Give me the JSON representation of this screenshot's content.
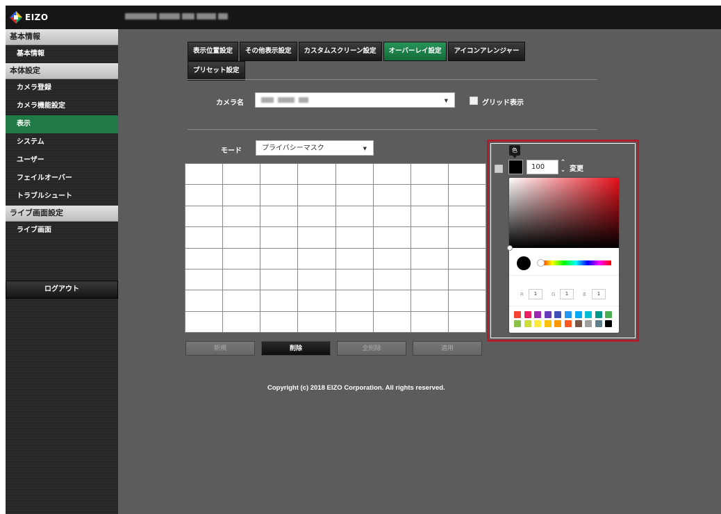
{
  "header": {
    "brand": "EIZO",
    "device_name_blurred_chunks": [
      46,
      30,
      18,
      28,
      14
    ]
  },
  "sidebar": {
    "sections": [
      {
        "title": "基本情報",
        "items": [
          {
            "label": "基本情報",
            "active": false
          }
        ]
      },
      {
        "title": "本体設定",
        "items": [
          {
            "label": "カメラ登録",
            "active": false
          },
          {
            "label": "カメラ機能設定",
            "active": false
          },
          {
            "label": "表示",
            "active": true
          },
          {
            "label": "システム",
            "active": false
          },
          {
            "label": "ユーザー",
            "active": false
          },
          {
            "label": "フェイルオーバー",
            "active": false
          },
          {
            "label": "トラブルシュート",
            "active": false
          }
        ]
      },
      {
        "title": "ライブ画面設定",
        "items": [
          {
            "label": "ライブ画面",
            "active": false
          }
        ]
      }
    ],
    "logout": "ログアウト"
  },
  "tabs": {
    "row1": [
      "表示位置設定",
      "その他表示設定",
      "カスタムスクリーン設定",
      "オーバーレイ設定",
      "アイコンアレンジャー"
    ],
    "row2": [
      "プリセット設定"
    ],
    "active": "オーバーレイ設定"
  },
  "camera": {
    "label": "カメラ名",
    "value_blurred": true,
    "grid_checkbox_label": "グリッド表示",
    "grid_checked": false
  },
  "mode": {
    "label": "モード",
    "value": "プライバシーマスク"
  },
  "grid": {
    "rows": 8,
    "cols": 8
  },
  "buttons": [
    {
      "label": "新規",
      "enabled": false
    },
    {
      "label": "削除",
      "enabled": true
    },
    {
      "label": "全削除",
      "enabled": false
    },
    {
      "label": "適用",
      "enabled": false
    }
  ],
  "color_panel": {
    "tooltip": "色",
    "checkbox_checked": false,
    "current_color": "#000000",
    "opacity": "100",
    "change_label": "変更",
    "rgb": {
      "r_label": "R",
      "r": "1",
      "g_label": "G",
      "g": "1",
      "b_label": "B",
      "b": "1"
    },
    "hue_color": "#e8101a",
    "palette": [
      "#f44336",
      "#e91e63",
      "#9c27b0",
      "#673ab7",
      "#3f51b5",
      "#2196f3",
      "#03a9f4",
      "#00bcd4",
      "#009688",
      "#4caf50",
      "#8bc34a",
      "#cddc39",
      "#ffeb3b",
      "#ffc107",
      "#ff9800",
      "#ff5722",
      "#795548",
      "#9e9e9e",
      "#607d8b",
      "#000000"
    ]
  },
  "footer": {
    "copyright": "Copyright (c) 2018 EIZO Corporation. All rights reserved."
  },
  "colors": {
    "accent_green": "#1f7a45",
    "highlight_red": "#b01e2e",
    "content_bg": "#5c5c5c"
  }
}
